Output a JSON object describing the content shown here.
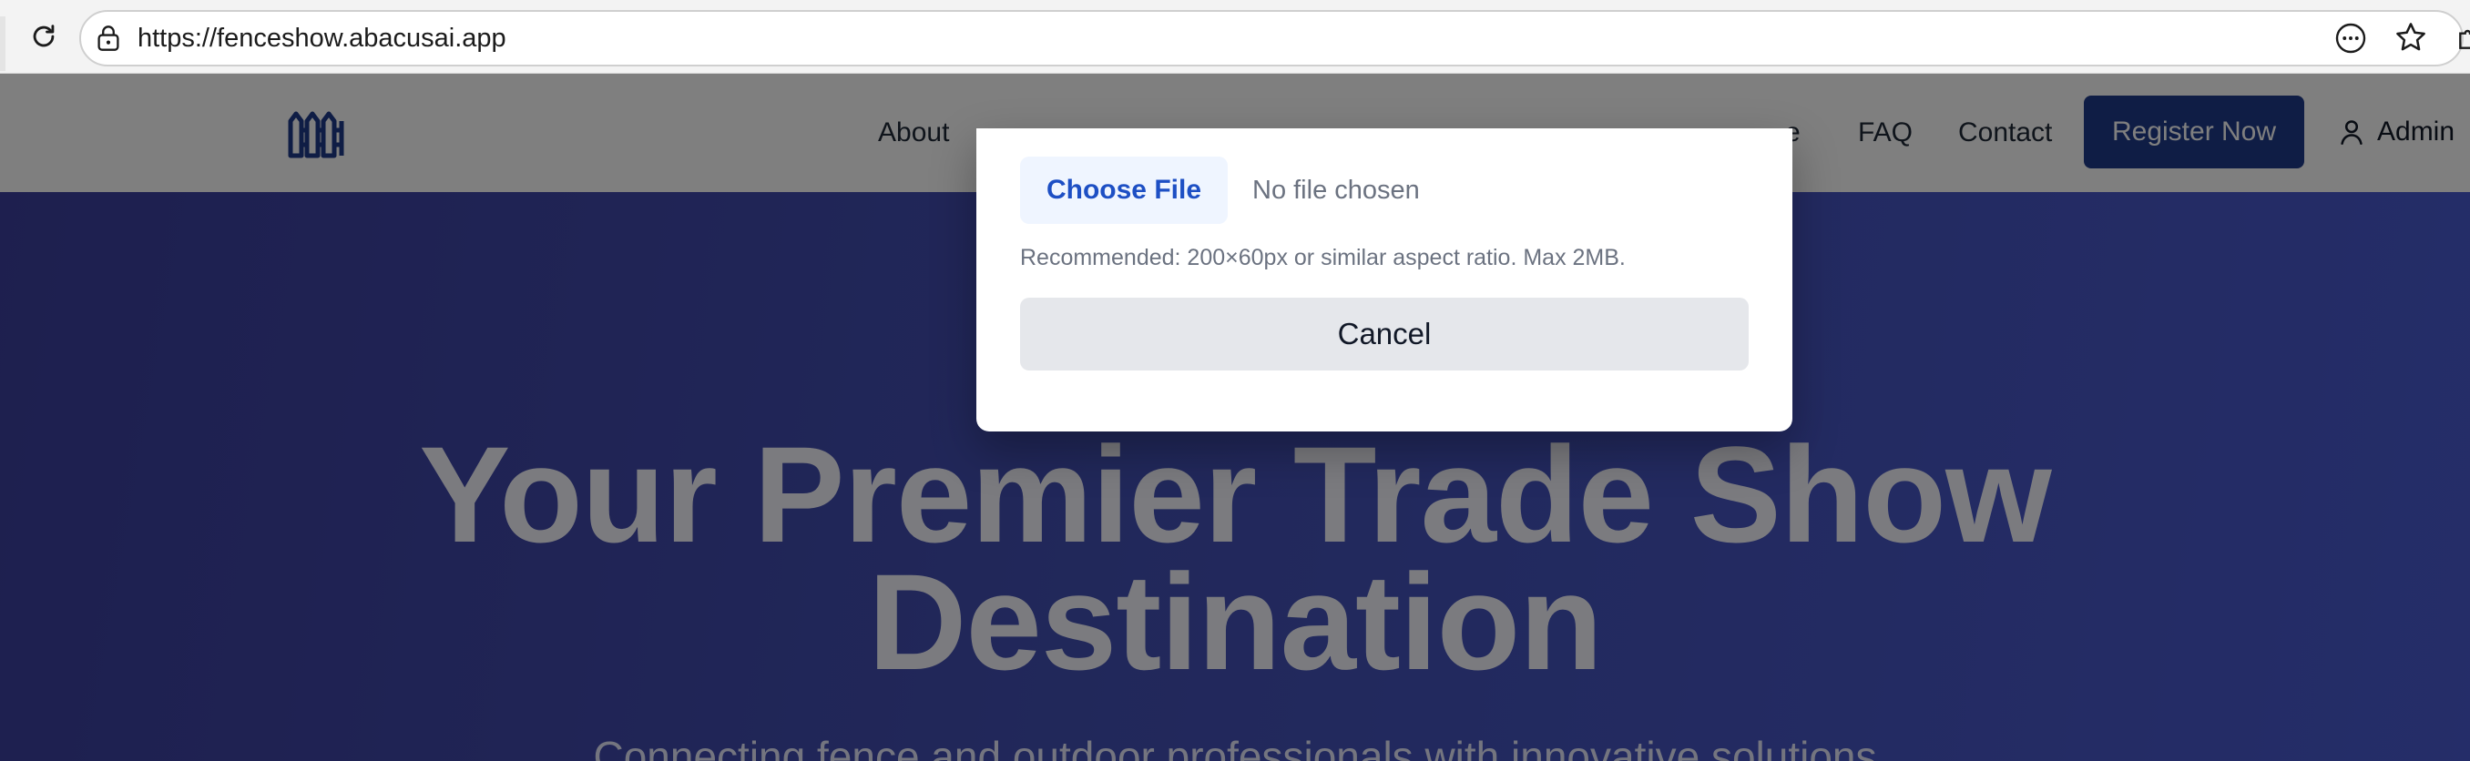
{
  "browser": {
    "url": "https://fenceshow.abacusai.app"
  },
  "header": {
    "nav": [
      {
        "label": "About"
      },
      {
        "label": "e"
      },
      {
        "label": "FAQ"
      },
      {
        "label": "Contact"
      }
    ],
    "register_label": "Register Now",
    "admin_label": "Admin"
  },
  "hero": {
    "title_line1": "Your Premier Trade Show",
    "title_line2": "Destination",
    "subtitle": "Connecting fence and outdoor professionals with innovative solutions"
  },
  "modal": {
    "choose_file_label": "Choose File",
    "file_status": "No file chosen",
    "hint": "Recommended: 200×60px or similar aspect ratio. Max 2MB.",
    "cancel_label": "Cancel"
  },
  "colors": {
    "brand": "#1e3a8a",
    "hero_start": "#3c3f9e",
    "hero_end": "#4a5bd2",
    "file_button_text": "#1d4fc4"
  }
}
